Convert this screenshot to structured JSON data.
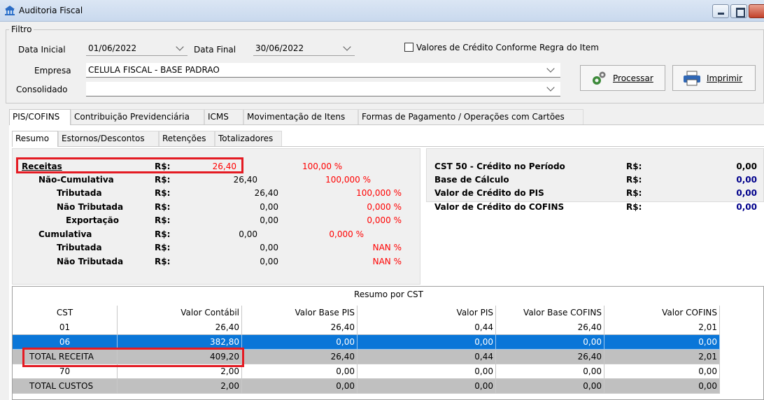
{
  "window": {
    "title": "Auditoria Fiscal"
  },
  "filter": {
    "legend": "Filtro",
    "data_inicial_label": "Data Inicial",
    "data_inicial_value": "01/06/2022",
    "data_final_label": "Data Final",
    "data_final_value": "30/06/2022",
    "checkbox_label": "Valores de Crédito Conforme Regra do Item",
    "empresa_label": "Empresa",
    "empresa_value": "CELULA FISCAL - BASE PADRAO",
    "consolidado_label": "Consolidado",
    "consolidado_value": "",
    "processar_label": "Processar",
    "imprimir_label": "Imprimir"
  },
  "main_tabs": [
    {
      "label": "PIS/COFINS"
    },
    {
      "label": "Contribuição Previdenciária"
    },
    {
      "label": "ICMS"
    },
    {
      "label": "Movimentação de Itens"
    },
    {
      "label": "Formas de Pagamento / Operações com Cartões"
    }
  ],
  "sub_tabs": [
    {
      "label": "Resumo"
    },
    {
      "label": "Estornos/Descontos"
    },
    {
      "label": "Retenções"
    },
    {
      "label": "Totalizadores"
    }
  ],
  "receitas": {
    "receitas": {
      "label": "Receitas",
      "cur": "R$:",
      "value": "26,40",
      "pct": "100,00 %"
    },
    "nao_cumulativa": {
      "label": "Não-Cumulativa",
      "cur": "R$:",
      "value": "26,40",
      "pct": "100,000 %"
    },
    "tributada": {
      "label": "Tributada",
      "cur": "R$:",
      "value": "26,40",
      "pct": "100,000 %"
    },
    "nao_tributada": {
      "label": "Não Tributada",
      "cur": "R$:",
      "value": "0,00",
      "pct": "0,000 %"
    },
    "exportacao": {
      "label": "Exportação",
      "cur": "R$:",
      "value": "0,00",
      "pct": "0,000 %"
    },
    "cumulativa": {
      "label": "Cumulativa",
      "cur": "R$:",
      "value": "0,00",
      "pct": "0,000 %"
    },
    "cum_tributada": {
      "label": "Tributada",
      "cur": "R$:",
      "value": "0,00",
      "pct": "NAN %"
    },
    "cum_nao_tributada": {
      "label": "Não Tributada",
      "cur": "R$:",
      "value": "0,00",
      "pct": "NAN %"
    }
  },
  "credito": {
    "cst50": {
      "label": "CST 50 - Crédito no Período",
      "cur": "R$:",
      "value": "0,00"
    },
    "base": {
      "label": "Base de Cálculo",
      "cur": "R$:",
      "value": "0,00"
    },
    "pis": {
      "label": "Valor de Crédito do PIS",
      "cur": "R$:",
      "value": "0,00"
    },
    "cofins": {
      "label": "Valor de Crédito do COFINS",
      "cur": "R$:",
      "value": "0,00"
    }
  },
  "resumo_cst": {
    "title": "Resumo por CST",
    "headers": [
      "CST",
      "Valor Contábil",
      "Valor Base PIS",
      "Valor PIS",
      "Valor Base COFINS",
      "Valor COFINS"
    ],
    "rows": [
      {
        "cst": "01",
        "contabil": "26,40",
        "base_pis": "26,40",
        "pis": "0,44",
        "base_cofins": "26,40",
        "cofins": "2,01"
      },
      {
        "cst": "06",
        "contabil": "382,80",
        "base_pis": "0,00",
        "pis": "0,00",
        "base_cofins": "0,00",
        "cofins": "0,00"
      },
      {
        "cst": "TOTAL RECEITA",
        "contabil": "409,20",
        "base_pis": "26,40",
        "pis": "0,44",
        "base_cofins": "26,40",
        "cofins": "2,01"
      },
      {
        "cst": "70",
        "contabil": "2,00",
        "base_pis": "0,00",
        "pis": "0,00",
        "base_cofins": "0,00",
        "cofins": "0,00"
      },
      {
        "cst": "TOTAL CUSTOS",
        "contabil": "2,00",
        "base_pis": "0,00",
        "pis": "0,00",
        "base_cofins": "0,00",
        "cofins": "0,00"
      }
    ]
  },
  "colors": {
    "accent": "#0a76d8",
    "highlight_box": "#e41b23",
    "negative": "#ff0000"
  }
}
